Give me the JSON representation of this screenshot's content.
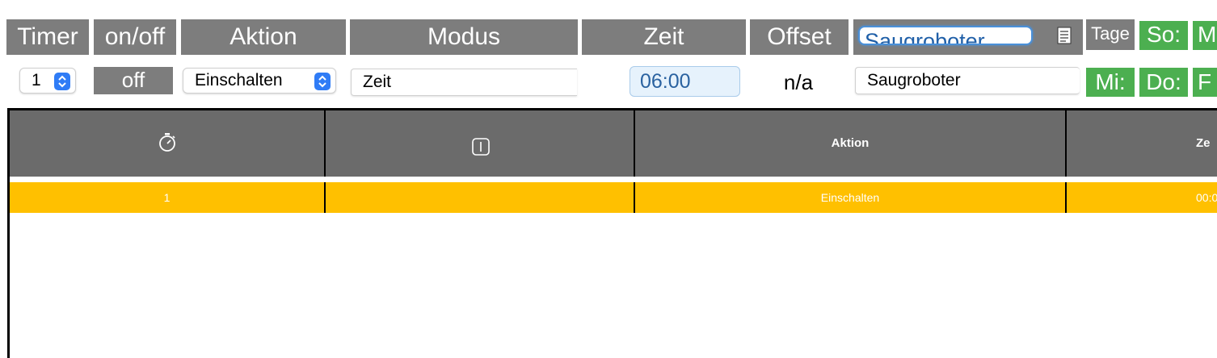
{
  "header": {
    "timer": "Timer",
    "onoff": "on/off",
    "aktion": "Aktion",
    "modus": "Modus",
    "zeit": "Zeit",
    "offset": "Offset",
    "device_name": "Saugroboter",
    "tage": "Tage",
    "day_so": "So:",
    "day_mo_partial": "M"
  },
  "controls": {
    "timer_select": "1",
    "onoff_button": "off",
    "aktion_select": "Einschalten",
    "modus_field": "Zeit",
    "zeit_value": "06:00",
    "offset_value": "n/a",
    "device_field": "Saugroboter",
    "day_mi": "Mi:",
    "day_do": "Do:",
    "day_fr_partial": "F"
  },
  "table": {
    "columns": [
      "",
      "",
      "Aktion",
      "Ze"
    ],
    "header_icons": [
      "stopwatch-icon",
      "power-toggle-icon"
    ],
    "rows": [
      {
        "timer": "1",
        "onoff": "",
        "aktion": "Einschalten",
        "zeit": "00:0"
      }
    ]
  },
  "colors": {
    "header_gray": "#7d7d7d",
    "day_green": "#4caf50",
    "table_header": "#6b6b6b",
    "row_highlight": "#ffc000",
    "select_blue": "#2f7cf6"
  }
}
